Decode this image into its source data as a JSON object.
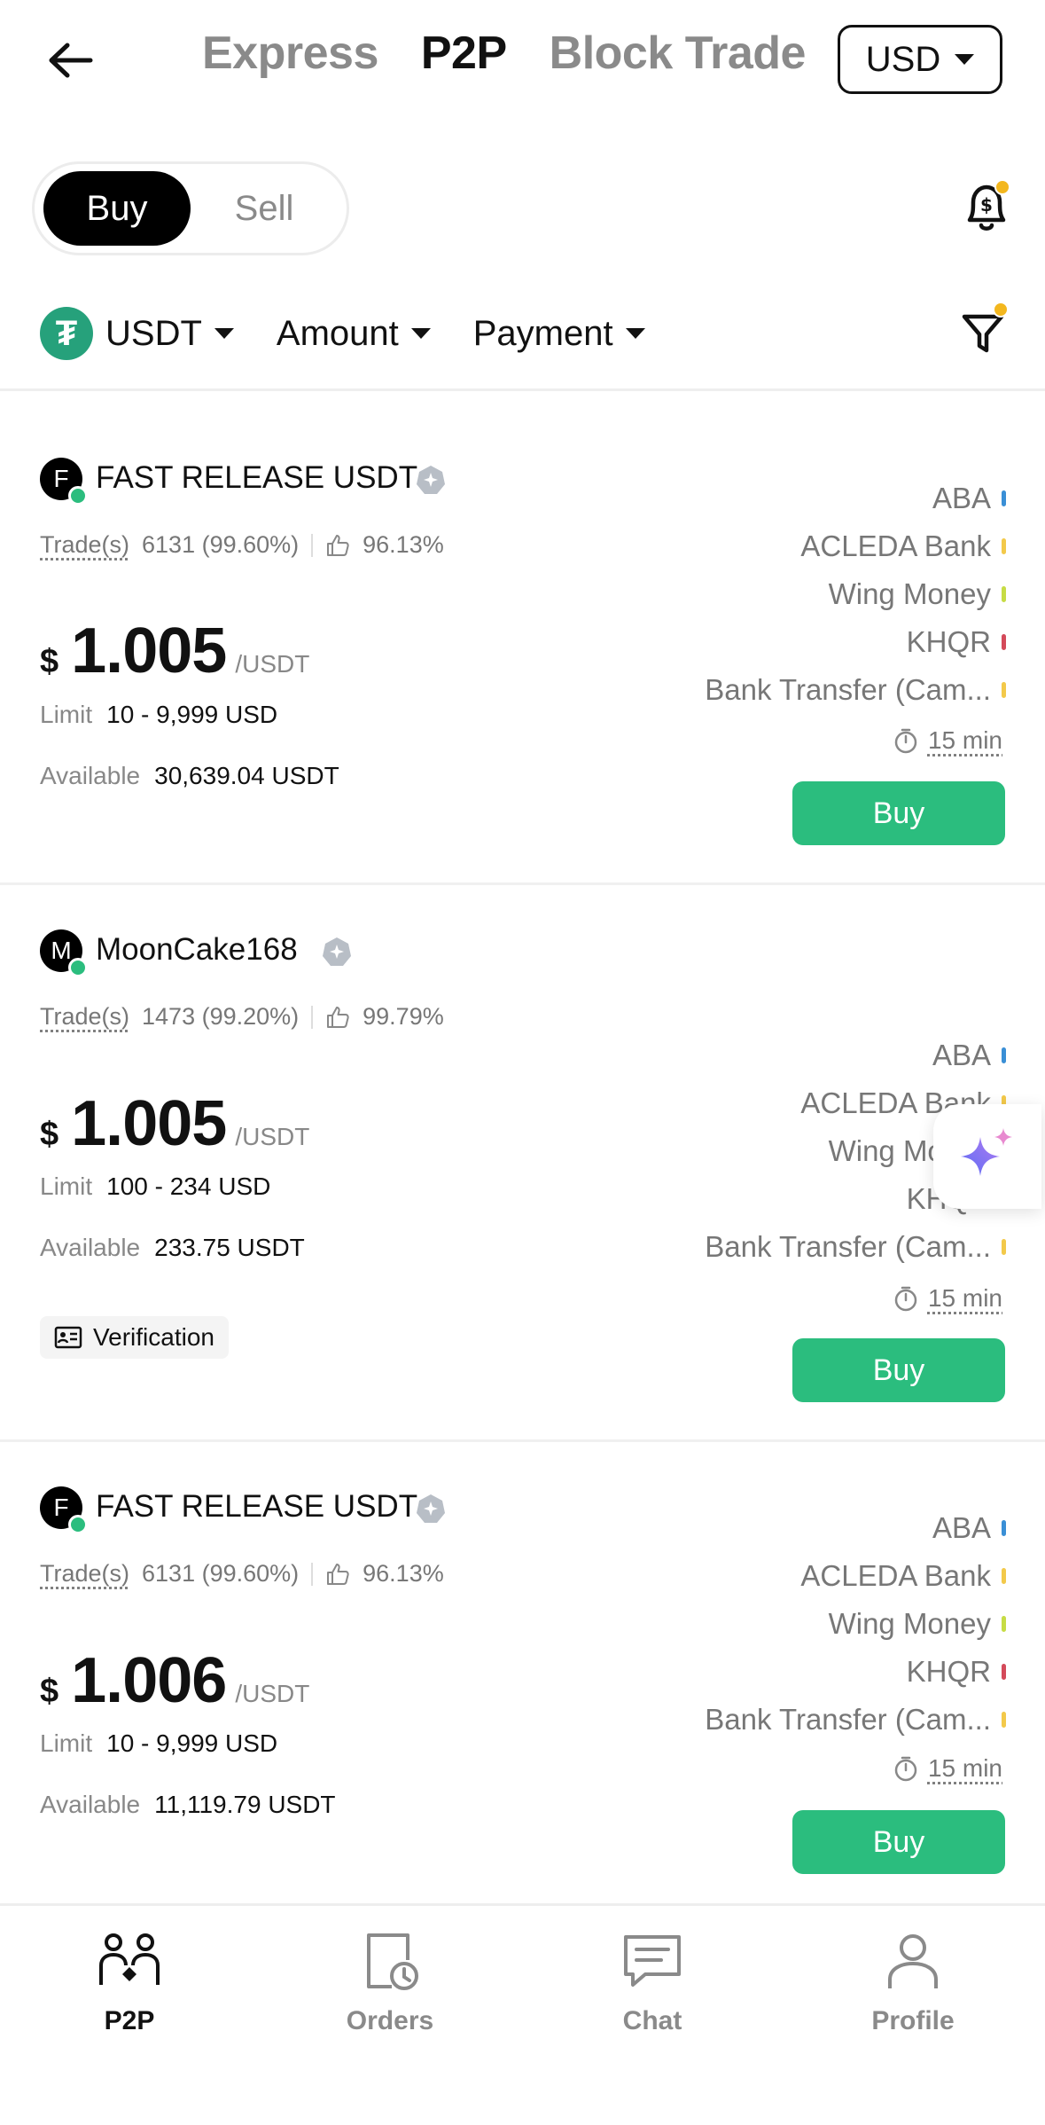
{
  "header": {
    "tabs": [
      "Express",
      "P2P",
      "Block Trade"
    ],
    "active_tab": "P2P",
    "currency": "USD"
  },
  "toggle": {
    "buy": "Buy",
    "sell": "Sell",
    "active": "Buy"
  },
  "filters": {
    "coin": "USDT",
    "amount": "Amount",
    "payment": "Payment"
  },
  "listings": [
    {
      "initial": "F",
      "name": "FAST RELEASE USDT",
      "trades_label": "Trade(s)",
      "trades": "6131 (99.60%)",
      "rating": "96.13%",
      "currency_symbol": "$",
      "price": "1.005",
      "unit": "/USDT",
      "limit_label": "Limit",
      "limit": "10 - 9,999 USD",
      "available_label": "Available",
      "available": "30,639.04 USDT",
      "payments": [
        {
          "name": "ABA",
          "color": "#3a8fd6"
        },
        {
          "name": "ACLEDA Bank",
          "color": "#f3c94a"
        },
        {
          "name": "Wing Money",
          "color": "#c7dc45"
        },
        {
          "name": "KHQR",
          "color": "#d44a5a"
        },
        {
          "name": "Bank Transfer (Cam...",
          "color": "#f3c94a"
        }
      ],
      "time": "15 min",
      "buy": "Buy"
    },
    {
      "initial": "M",
      "name": "MoonCake168",
      "trades_label": "Trade(s)",
      "trades": "1473 (99.20%)",
      "rating": "99.79%",
      "currency_symbol": "$",
      "price": "1.005",
      "unit": "/USDT",
      "limit_label": "Limit",
      "limit": "100 - 234 USD",
      "available_label": "Available",
      "available": "233.75 USDT",
      "verification": "Verification",
      "payments": [
        {
          "name": "ABA",
          "color": "#3a8fd6"
        },
        {
          "name": "ACLEDA Bank",
          "color": "#f3c94a"
        },
        {
          "name": "Wing Money",
          "color": "#c7dc45"
        },
        {
          "name": "KHQR",
          "color": "#d44a5a"
        },
        {
          "name": "Bank Transfer (Cam...",
          "color": "#f3c94a"
        }
      ],
      "time": "15 min",
      "buy": "Buy"
    },
    {
      "initial": "F",
      "name": "FAST RELEASE USDT",
      "trades_label": "Trade(s)",
      "trades": "6131 (99.60%)",
      "rating": "96.13%",
      "currency_symbol": "$",
      "price": "1.006",
      "unit": "/USDT",
      "limit_label": "Limit",
      "limit": "10 - 9,999 USD",
      "available_label": "Available",
      "available": "11,119.79 USDT",
      "payments": [
        {
          "name": "ABA",
          "color": "#3a8fd6"
        },
        {
          "name": "ACLEDA Bank",
          "color": "#f3c94a"
        },
        {
          "name": "Wing Money",
          "color": "#c7dc45"
        },
        {
          "name": "KHQR",
          "color": "#d44a5a"
        },
        {
          "name": "Bank Transfer (Cam...",
          "color": "#f3c94a"
        }
      ],
      "time": "15 min",
      "buy": "Buy"
    }
  ],
  "bottom_nav": [
    {
      "label": "P2P",
      "icon": "p2p-icon",
      "active": true
    },
    {
      "label": "Orders",
      "icon": "orders-icon",
      "active": false
    },
    {
      "label": "Chat",
      "icon": "chat-icon",
      "active": false
    },
    {
      "label": "Profile",
      "icon": "profile-icon",
      "active": false
    }
  ],
  "colors": {
    "accent_green": "#2bbd7e",
    "usdt_green": "#26a17b",
    "notification_dot": "#f3b71e"
  }
}
